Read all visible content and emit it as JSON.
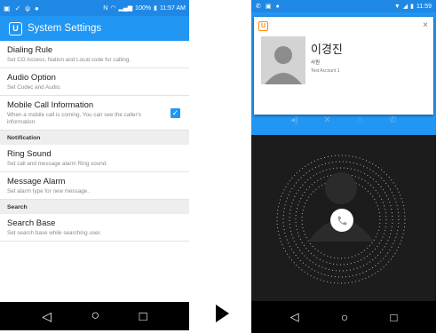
{
  "left_phone": {
    "status_bar": {
      "time": "11:57 AM",
      "battery": "100%"
    },
    "app_title": "System Settings",
    "app_logo_letter": "U",
    "items": [
      {
        "title": "Dialing Rule",
        "desc": "Set CO Access, Nation and Local code for calling."
      },
      {
        "title": "Audio Option",
        "desc": "Set Codec and Audio."
      },
      {
        "title": "Mobile Call Information",
        "desc": "When a mobile call is coming, You can see the caller's information.",
        "checked": true
      },
      {
        "section": "Notification"
      },
      {
        "title": "Ring Sound",
        "desc": "Set call and message alarm Ring sound."
      },
      {
        "title": "Message Alarm",
        "desc": "Set alarm type for new message."
      },
      {
        "section": "Search"
      },
      {
        "title": "Search Base",
        "desc": "Set search base while searching user."
      }
    ],
    "nav": {
      "back": "◁",
      "home": "○",
      "recent": "□"
    }
  },
  "right_phone": {
    "status_bar": {
      "time": "11:59"
    },
    "notification": {
      "logo_letter": "U",
      "close": "×",
      "caller_name": "이경진",
      "caller_rank": "사원",
      "caller_dept": "Test Account 1"
    },
    "nav": {
      "back": "◁",
      "home": "○",
      "recent": "□"
    }
  },
  "colors": {
    "accent": "#2196f3",
    "status": "#1f88e5",
    "dark": "#1c1c1c",
    "orange": "#ff8a00"
  }
}
